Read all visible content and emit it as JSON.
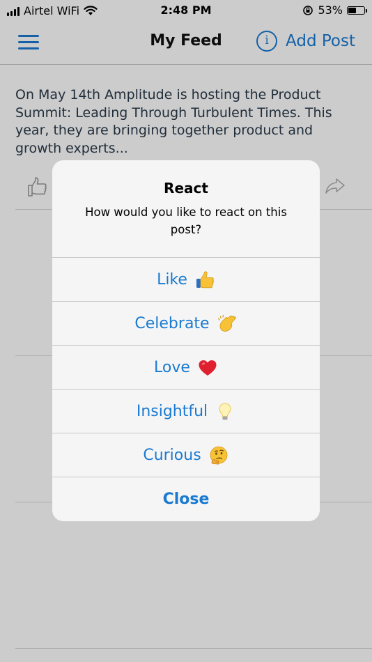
{
  "status_bar": {
    "carrier": "Airtel WiFi",
    "time": "2:48 PM",
    "battery": "53%",
    "battery_level": 0.53
  },
  "nav": {
    "title": "My Feed",
    "add_post_label": "Add Post",
    "menu_icon": "hamburger-menu-icon",
    "info_icon": "info-circle-icon"
  },
  "post": {
    "text": "On May 14th Amplitude is hosting the Product Summit: Leading Through Turbulent Times. This year, they are bringing together product and growth experts..."
  },
  "dialog": {
    "title": "React",
    "message": "How would you like to react on this post?",
    "options": [
      {
        "label": "Like",
        "icon": "thumbs-up-emoji"
      },
      {
        "label": "Celebrate",
        "icon": "clapping-hands-emoji"
      },
      {
        "label": "Love",
        "icon": "red-heart-emoji"
      },
      {
        "label": "Insightful",
        "icon": "light-bulb-emoji"
      },
      {
        "label": "Curious",
        "icon": "thinking-face-emoji"
      }
    ],
    "close_label": "Close"
  },
  "colors": {
    "accent": "#1a7ad1",
    "heart": "#e0202e",
    "emoji_yellow": "#f7c236"
  }
}
